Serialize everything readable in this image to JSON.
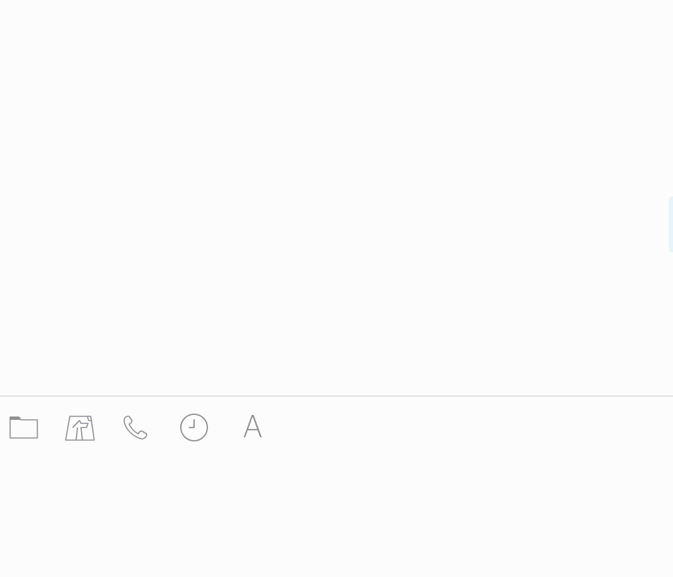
{
  "theme": {
    "background": "#fcfcfc",
    "icon_color": "#8e8e93",
    "divider_color": "#e4e4e6",
    "side_tab_color": "#e6f4fb"
  },
  "toolbar": {
    "items": [
      {
        "name": "folder",
        "icon": "folder-icon"
      },
      {
        "name": "map",
        "icon": "map-icon"
      },
      {
        "name": "phone",
        "icon": "phone-icon"
      },
      {
        "name": "clock",
        "icon": "clock-icon"
      },
      {
        "name": "font",
        "icon": "letter-a-icon",
        "glyph": "A"
      }
    ]
  }
}
